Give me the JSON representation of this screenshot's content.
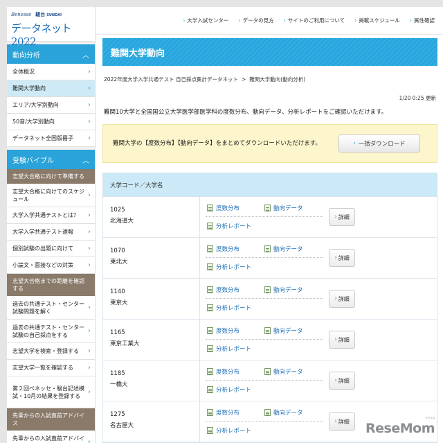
{
  "brand": {
    "benesse": "Benesse",
    "sundai": "駿台",
    "sundai_sub": "SUNDAI",
    "site_title": "データネット2022"
  },
  "topnav": [
    {
      "label": "大学入試センター"
    },
    {
      "label": "データの見方"
    },
    {
      "label": "サイトのご利用について"
    },
    {
      "label": "掲載スケジュール"
    },
    {
      "label": "属性確認"
    }
  ],
  "sidebar": {
    "section1": {
      "label": "動向分析",
      "items": [
        {
          "label": "全体概況"
        },
        {
          "label": "難関大学動向"
        },
        {
          "label": "エリア/大学別動向"
        },
        {
          "label": "50音/大学別動向"
        },
        {
          "label": "データネット全国版冊子"
        }
      ]
    },
    "section2": {
      "label": "受験バイブル"
    },
    "group1": "志望大合格に向けて準備する",
    "items2": [
      {
        "label": "志望大合格に向けてのスケジュール"
      },
      {
        "label": "大学入学共通テストとは？"
      },
      {
        "label": "大学入学共通テスト速報"
      },
      {
        "label": "個別試験の出題に向けて"
      },
      {
        "label": "小論文・面接などの対策"
      }
    ],
    "group2": "志望大合格までの距離を確認する",
    "items3": [
      {
        "label": "過去の共通テスト・センター試験問題を解く"
      },
      {
        "label": "過去の共通テスト・センター試験の自己採点をする"
      },
      {
        "label": "志望大学を検索・登録する"
      },
      {
        "label": "志望大学一覧を確認する"
      },
      {
        "label": "第２回ベネッセ・駿台記述模試・10月の結果を登録する"
      }
    ],
    "group3": "先輩からの入試直前アドバイス",
    "items4": [
      {
        "label": "先輩からの入試直前アドバイス"
      }
    ]
  },
  "main": {
    "banner": "難関大学動向",
    "breadcrumb": {
      "parent": "2022年度大学入学共通テスト 自己採点集計データネット",
      "sep": ">",
      "current": "難関大学動向(動向分析)"
    },
    "updated": "1/20 0:25 更新",
    "intro": "難関10大学と全国国公立大学医学部医学科の度数分布、動向データ、分析レポートをご確認いただけます。",
    "notice": "難関大学の【度数分布】【動向データ】をまとめてダウンロードいただけます。",
    "download_label": "一括ダウンロード",
    "table_header": "大学コード／大学名",
    "link_labels": {
      "dist": "度数分布",
      "trend": "動向データ",
      "report": "分析レポート",
      "detail": "詳細"
    },
    "rows": [
      {
        "code": "1025",
        "name": "北海道大"
      },
      {
        "code": "1070",
        "name": "東北大"
      },
      {
        "code": "1140",
        "name": "東京大"
      },
      {
        "code": "1165",
        "name": "東京工業大"
      },
      {
        "code": "1185",
        "name": "一橋大"
      },
      {
        "code": "1275",
        "name": "名古屋大"
      }
    ]
  },
  "watermark": {
    "text": "ReseMom",
    "sub": "リセマム"
  },
  "colors": {
    "accent": "#29a3d9",
    "banner": "#26a6de",
    "notice_bg": "#fdf5cc",
    "table_head": "#cbe9f6",
    "link": "#1f6fb5"
  }
}
